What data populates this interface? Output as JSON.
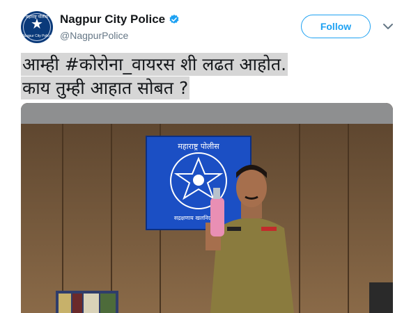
{
  "tweet": {
    "avatar": {
      "top_text": "महाराष्ट्र पोलीस",
      "bottom_text": "Nagpur City Police"
    },
    "display_name": "Nagpur City Police",
    "verified": true,
    "handle": "@NagpurPolice",
    "follow_label": "Follow",
    "text_lines": [
      "आम्ही #कोरोना_वायरस शी  लढत आहोत.",
      "काय तुम्ही आहात सोबत ?"
    ],
    "media": {
      "sign_text_top": "महाराष्ट्र पोलीस",
      "sign_text_bottom": "सद्रक्षणाय खलनिग्रहणाय"
    }
  },
  "colors": {
    "accent": "#1da1f2",
    "text": "#14171a",
    "muted": "#657786",
    "highlight": "#d6d6d6"
  }
}
